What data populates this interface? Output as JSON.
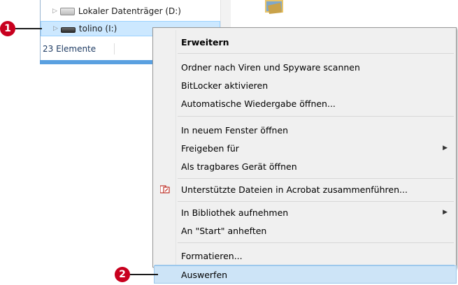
{
  "explorer": {
    "tree": [
      {
        "label": "Lokaler Datenträger (D:)",
        "icon": "hard-drive-icon"
      },
      {
        "label": "tolino (I:)",
        "icon": "usb-drive-icon",
        "selected": true
      }
    ],
    "status": "23 Elemente"
  },
  "menu": {
    "items": [
      {
        "label": "Erweitern",
        "bold": true
      },
      {
        "label": "Ordner nach Viren und Spyware scannen"
      },
      {
        "label": "BitLocker aktivieren"
      },
      {
        "label": "Automatische Wiedergabe öffnen..."
      },
      {
        "label": "In neuem Fenster öffnen"
      },
      {
        "label": "Freigeben für",
        "submenu": true
      },
      {
        "label": "Als tragbares Gerät öffnen"
      },
      {
        "label": "Unterstützte Dateien in Acrobat zusammenführen...",
        "icon": "acrobat-icon"
      },
      {
        "label": "In Bibliothek aufnehmen",
        "submenu": true
      },
      {
        "label": "An \"Start\" anheften"
      },
      {
        "label": "Formatieren..."
      },
      {
        "label": "Auswerfen",
        "highlighted": true
      }
    ]
  },
  "callouts": [
    "1",
    "2"
  ],
  "colors": {
    "callout": "#c8001e",
    "selection": "#cce8ff",
    "menu_bg": "#f0f0f0"
  }
}
